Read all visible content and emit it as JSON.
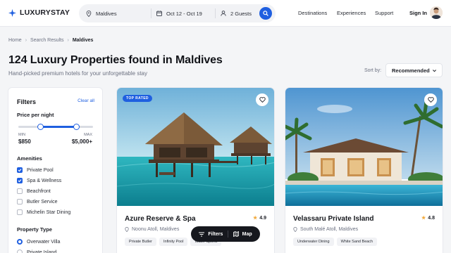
{
  "brand": {
    "name": "LUXURYSTAY",
    "accent": "#1f5fe0"
  },
  "search": {
    "location": "Maldives",
    "dates": "Oct 12 - Oct 19",
    "guests": "2 Guests"
  },
  "nav": {
    "destinations": "Destinations",
    "experiences": "Experiences",
    "support": "Support",
    "signin": "Sign In"
  },
  "breadcrumb": [
    "Home",
    "Search Results",
    "Maldives"
  ],
  "heading": {
    "title": "124 Luxury Properties found in Maldives",
    "subtitle": "Hand-picked premium hotels for your unforgettable stay"
  },
  "sort": {
    "label": "Sort by:",
    "value": "Recommended"
  },
  "filters": {
    "title": "Filters",
    "clear": "Clear all",
    "price": {
      "heading": "Price per night",
      "min_label": "MIN",
      "max_label": "MAX",
      "min_value": "$850",
      "max_value": "$5,000+",
      "min_fraction": 0.3,
      "max_fraction": 0.78
    },
    "amenities": {
      "heading": "Amenities",
      "items": [
        {
          "label": "Private Pool",
          "checked": true
        },
        {
          "label": "Spa & Wellness",
          "checked": true
        },
        {
          "label": "Beachfront",
          "checked": false
        },
        {
          "label": "Butler Service",
          "checked": false
        },
        {
          "label": "Michelin Star Dining",
          "checked": false
        }
      ]
    },
    "property_type": {
      "heading": "Property Type",
      "items": [
        {
          "label": "Overwater Villa",
          "selected": true
        },
        {
          "label": "Private Island",
          "selected": false
        }
      ]
    }
  },
  "cards": [
    {
      "badge": "TOP RATED",
      "name": "Azure Reserve & Spa",
      "rating": "4.9",
      "location": "Noonu Atoll, Maldives",
      "tags": [
        "Private Butler",
        "Infinity Pool",
        "Water Sports"
      ]
    },
    {
      "badge": "",
      "name": "Velassaru Private Island",
      "rating": "4.8",
      "location": "South Malé Atoll, Maldives",
      "tags": [
        "Underwater Dining",
        "White Sand Beach"
      ]
    }
  ],
  "floating": {
    "filters": "Filters",
    "map": "Map"
  }
}
